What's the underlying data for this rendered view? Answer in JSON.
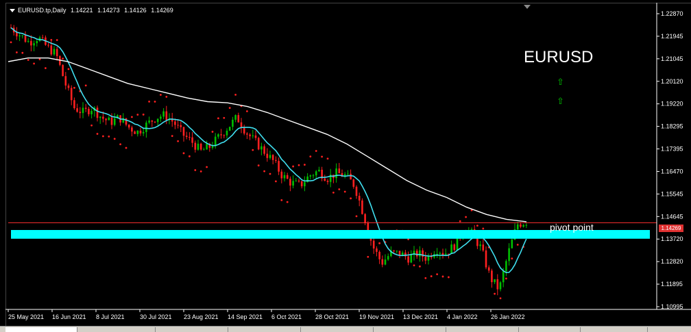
{
  "header": {
    "symbol": "EURUSD.tp,Daily",
    "open": "1.14221",
    "high": "1.14273",
    "low": "1.14126",
    "close": "1.14269"
  },
  "overlay": {
    "title": "EURUSD",
    "pivot_label": "pivot point",
    "current_price": "1.14269",
    "signal_icons": [
      "up-arrow-icon",
      "up-arrow-icon"
    ],
    "signal_color": "#00c000"
  },
  "colors": {
    "background": "#000000",
    "bull_candle": "#00c000",
    "bear_candle": "#ff2020",
    "fast_ma": "#40e0f0",
    "slow_ma": "#ffffff",
    "psar": "#ff2020",
    "pivot_line": "#ff3030",
    "pivot_zone": "#00ffff"
  },
  "chart_data": {
    "type": "candlestick",
    "y_ticks": [
      "1.22870",
      "1.21945",
      "1.21045",
      "1.20120",
      "1.19220",
      "1.18295",
      "1.17395",
      "1.16470",
      "1.15545",
      "1.14645",
      "1.13720",
      "1.12820",
      "1.11895",
      "1.10995"
    ],
    "x_ticks": [
      "25 May 2021",
      "16 Jun 2021",
      "8 Jul 2021",
      "30 Jul 2021",
      "23 Aug 2021",
      "14 Sep 2021",
      "6 Oct 2021",
      "28 Oct 2021",
      "19 Nov 2021",
      "13 Dec 2021",
      "4 Jan 2022",
      "26 Jan 2022"
    ],
    "ylim": [
      1.108,
      1.231
    ],
    "pivot_level": 1.1426,
    "zone": [
      1.136,
      1.1396
    ],
    "close_path": [
      1.223,
      1.22,
      1.217,
      1.219,
      1.215,
      1.212,
      1.2,
      1.19,
      1.188,
      1.19,
      1.186,
      1.184,
      1.186,
      1.182,
      1.18,
      1.183,
      1.186,
      1.187,
      1.184,
      1.179,
      1.176,
      1.172,
      1.174,
      1.178,
      1.182,
      1.186,
      1.18,
      1.176,
      1.172,
      1.168,
      1.162,
      1.159,
      1.158,
      1.162,
      1.164,
      1.161,
      1.163,
      1.162,
      1.158,
      1.146,
      1.133,
      1.126,
      1.13,
      1.13,
      1.128,
      1.13,
      1.128,
      1.132,
      1.13,
      1.133,
      1.14,
      1.138,
      1.132,
      1.12,
      1.115,
      1.13,
      1.142,
      1.143
    ],
    "slow_ma_path": [
      1.209,
      1.2105,
      1.2105,
      1.209,
      1.206,
      1.203,
      1.2,
      1.198,
      1.196,
      1.194,
      1.1925,
      1.192,
      1.1905,
      1.188,
      1.185,
      1.182,
      1.179,
      1.175,
      1.17,
      1.165,
      1.16,
      1.156,
      1.153,
      1.149,
      1.146,
      1.144,
      1.143
    ]
  }
}
